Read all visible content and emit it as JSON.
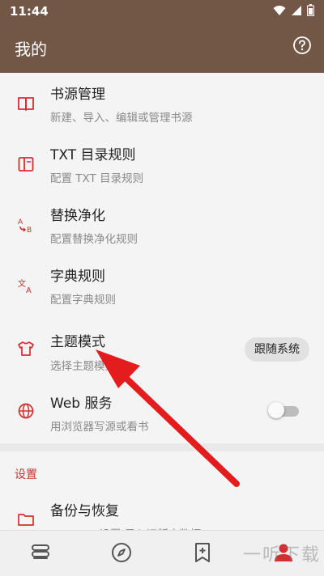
{
  "status_bar": {
    "time": "11:44",
    "icons": [
      "wifi-icon",
      "signal-icon",
      "battery-icon"
    ]
  },
  "app_bar": {
    "title": "我的",
    "help_icon": "help-circle-icon"
  },
  "items": [
    {
      "title": "书源管理",
      "subtitle": "新建、导入、编辑或管理书源",
      "icon": "book-open-icon"
    },
    {
      "title": "TXT 目录规则",
      "subtitle": "配置 TXT 目录规则",
      "icon": "book-toc-icon"
    },
    {
      "title": "替换净化",
      "subtitle": "配置替换净化规则",
      "icon": "replace-ab-icon"
    },
    {
      "title": "字典规则",
      "subtitle": "配置字典规则",
      "icon": "translate-icon"
    },
    {
      "title": "主题模式",
      "subtitle": "选择主题模式",
      "icon": "tshirt-icon",
      "value": "跟随系统"
    },
    {
      "title": "Web 服务",
      "subtitle": "用浏览器写源或看书",
      "icon": "globe-icon",
      "toggle_on": false
    }
  ],
  "section": {
    "header": "设置",
    "items": [
      {
        "title": "备份与恢复",
        "subtitle": "WebDav 设置/导入旧版本数据",
        "icon": "folder-icon"
      }
    ]
  },
  "bottom_nav": {
    "items": [
      {
        "icon": "bookshelf-icon"
      },
      {
        "icon": "compass-icon"
      },
      {
        "icon": "bookmark-plus-icon"
      },
      {
        "icon": "person-icon",
        "active": true
      }
    ]
  },
  "watermark": "一听下载",
  "colors": {
    "primary": "#735746",
    "accent": "#d32f2f",
    "arrow": "#e31d1d"
  }
}
